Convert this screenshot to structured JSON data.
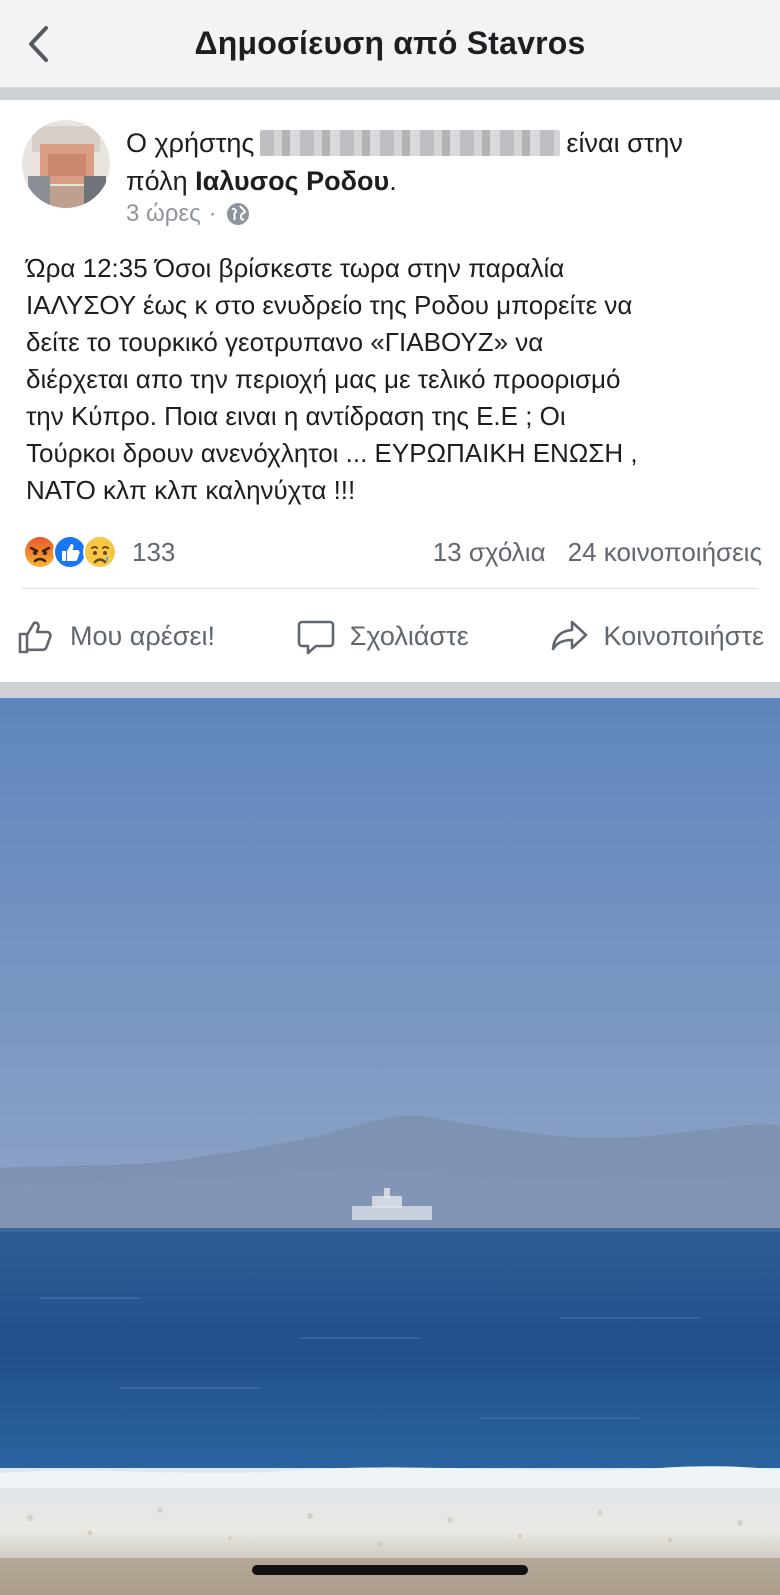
{
  "header": {
    "title": "Δημοσίευση από Stavros",
    "back_icon": "chevron-left-icon"
  },
  "post": {
    "author_prefix": "Ο χρήστης",
    "author_suffix": "είναι στην",
    "location_prefix": "πόλη",
    "location": "Ιαλυσος Ροδου",
    "location_end": ".",
    "time": "3 ώρες",
    "time_separator": "·",
    "privacy_icon": "globe-icon",
    "text": "Ώρα 12:35 Όσοι βρίσκεστε τωρα στην παραλία\nΙΑΛΥΣΟΥ έως κ στο ενυδρείο της Ροδου μπορείτε να\nδείτε το τουρκικό γεοτρυπανο «ΓΙΑΒΟΥΖ» να\nδιέρχεται απο την περιοχή μας με τελικό προορισμό\nτην Κύπρο. Ποια ειναι η αντίδραση της Ε.Ε ; Οι\nΤούρκοι δρουν ανενόχλητοι ... ΕΥΡΩΠΑΙΚΗ ΕΝΩΣΗ ,\nΝΑΤΟ κλπ κλπ καληνύχτα !!!",
    "reactions": {
      "icons": [
        "angry-icon",
        "like-icon",
        "sad-icon"
      ],
      "count": "133",
      "comments": "13 σχόλια",
      "shares": "24 κοινοποιήσεις"
    },
    "actions": {
      "like": "Μου αρέσει!",
      "comment": "Σχολιάστε",
      "share": "Κοινοποιήστε"
    }
  },
  "colors": {
    "header_bg": "#f3f3f5",
    "separator": "#cdd0d5",
    "meta_gray": "#8d949e",
    "action_gray": "#606770",
    "like_blue": "#1877f2",
    "sky": "#6d8fbe",
    "sea": "#234f86"
  }
}
